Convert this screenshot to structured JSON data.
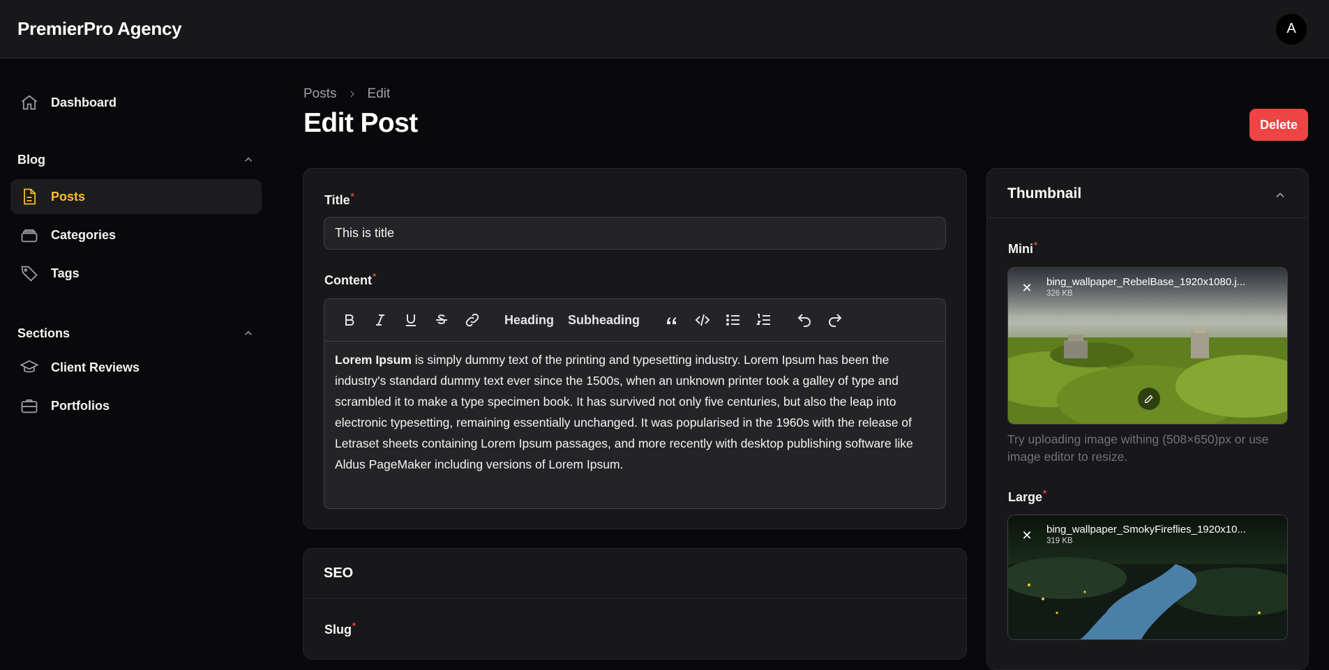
{
  "app": {
    "brand": "PremierPro Agency",
    "avatar_initial": "A"
  },
  "sidebar": {
    "dashboard": "Dashboard",
    "groups": [
      {
        "label": "Blog",
        "items": [
          "Posts",
          "Categories",
          "Tags"
        ]
      },
      {
        "label": "Sections",
        "items": [
          "Client Reviews",
          "Portfolios"
        ]
      }
    ],
    "active_item": "Posts"
  },
  "breadcrumb": [
    "Posts",
    "Edit"
  ],
  "page": {
    "title": "Edit Post",
    "delete_label": "Delete"
  },
  "form": {
    "title_label": "Title",
    "title_value": "This is title",
    "content_label": "Content",
    "toolbar": {
      "heading": "Heading",
      "subheading": "Subheading"
    },
    "content_html_text": {
      "bold": "Lorem Ipsum",
      "rest": " is simply dummy text of the printing and typesetting industry. Lorem Ipsum has been the industry's standard dummy text ever since the 1500s, when an unknown printer took a galley of type and scrambled it to make a type specimen book. It has survived not only five centuries, but also the leap into electronic typesetting, remaining essentially unchanged. It was popularised in the 1960s with the release of Letraset sheets containing Lorem Ipsum passages, and more recently with desktop publishing software like Aldus PageMaker including versions of Lorem Ipsum."
    }
  },
  "seo": {
    "title": "SEO",
    "slug_label": "Slug"
  },
  "thumbnail": {
    "title": "Thumbnail",
    "mini": {
      "label": "Mini",
      "file_name": "bing_wallpaper_RebelBase_1920x1080.j...",
      "file_size": "326 KB",
      "help": "Try uploading image withing (508×650)px or use image editor to resize."
    },
    "large": {
      "label": "Large",
      "file_name": "bing_wallpaper_SmokyFireflies_1920x10...",
      "file_size": "319 KB"
    }
  },
  "colors": {
    "accent": "#fbbf24",
    "danger": "#ef4444",
    "background": "#09090b",
    "surface": "#18181b"
  }
}
